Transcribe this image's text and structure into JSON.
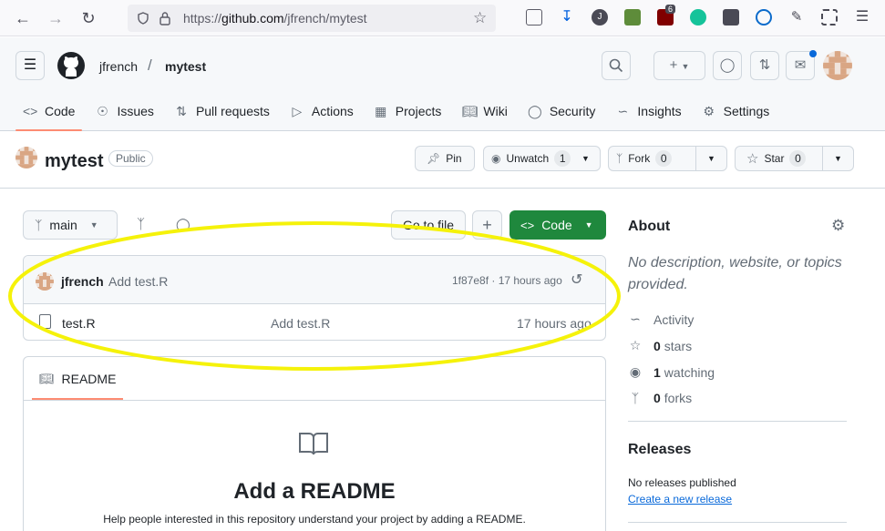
{
  "browser": {
    "url_prefix": "https://",
    "url_host": "github.com",
    "url_path": "/jfrench/mytest",
    "badge_count": "6"
  },
  "header": {
    "owner": "jfrench",
    "separator": "/",
    "repo": "mytest"
  },
  "tabs": [
    {
      "label": "Code",
      "icon": "code-icon"
    },
    {
      "label": "Issues",
      "icon": "issue-icon"
    },
    {
      "label": "Pull requests",
      "icon": "pull-request-icon"
    },
    {
      "label": "Actions",
      "icon": "play-icon"
    },
    {
      "label": "Projects",
      "icon": "table-icon"
    },
    {
      "label": "Wiki",
      "icon": "book-icon"
    },
    {
      "label": "Security",
      "icon": "shield-icon"
    },
    {
      "label": "Insights",
      "icon": "graph-icon"
    },
    {
      "label": "Settings",
      "icon": "gear-icon"
    }
  ],
  "repo": {
    "name": "mytest",
    "visibility": "Public",
    "pin_label": "Pin",
    "unwatch_label": "Unwatch",
    "watch_count": "1",
    "fork_label": "Fork",
    "fork_count": "0",
    "star_label": "Star",
    "star_count": "0"
  },
  "file_nav": {
    "branch": "main",
    "go_to_file": "Go to file",
    "code_button": "Code"
  },
  "latest_commit": {
    "author": "jfrench",
    "message": "Add test.R",
    "meta": "1f87e8f · 17 hours ago"
  },
  "files": [
    {
      "name": "test.R",
      "commit": "Add test.R",
      "age": "17 hours ago"
    }
  ],
  "readme": {
    "tab": "README",
    "heading": "Add a README",
    "help": "Help people interested in this repository understand your project by adding a README."
  },
  "sidebar": {
    "about_title": "About",
    "description": "No description, website, or topics provided.",
    "activity": "Activity",
    "stars_count": "0",
    "stars_label": "stars",
    "watching_count": "1",
    "watching_label": "watching",
    "forks_count": "0",
    "forks_label": "forks",
    "releases_title": "Releases",
    "no_releases": "No releases published",
    "create_release": "Create a new release"
  },
  "colors": {
    "accent_green": "#1f883d",
    "tab_underline": "#fd8c73",
    "annotation_yellow": "#f5f20a"
  }
}
